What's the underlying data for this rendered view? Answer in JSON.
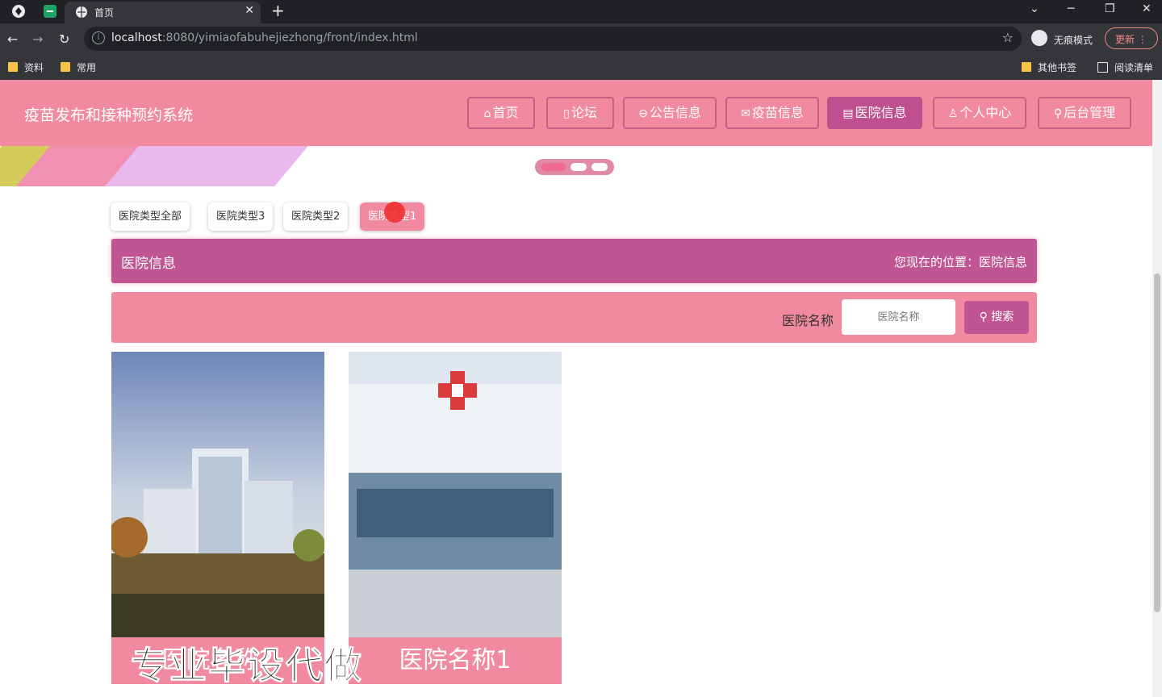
{
  "browser": {
    "tab_title": "首页",
    "new_tab": "+",
    "url_host": "localhost",
    "url_rest": ":8080/yimiaofabuhejiezhong/front/index.html",
    "incognito_label": "无痕模式",
    "update_label": "更新",
    "bookmarks": [
      "资料",
      "常用"
    ],
    "bookmarks_right": [
      "其他书签",
      "阅读清单"
    ]
  },
  "site": {
    "title": "疫苗发布和接种预约系统",
    "nav": [
      {
        "icon": "⌂",
        "label": "首页"
      },
      {
        "icon": "▯",
        "label": "论坛"
      },
      {
        "icon": "⊖",
        "label": "公告信息"
      },
      {
        "icon": "✉",
        "label": "疫苗信息"
      },
      {
        "icon": "▤",
        "label": "医院信息"
      },
      {
        "icon": "♙",
        "label": "个人中心"
      },
      {
        "icon": "⚲",
        "label": "后台管理"
      }
    ],
    "active_nav": "医院信息"
  },
  "filters": [
    "医院类型全部",
    "医院类型3",
    "医院类型2",
    "医院类型1"
  ],
  "section": {
    "title": "医院信息",
    "breadcrumb": "您现在的位置：医院信息"
  },
  "search": {
    "label": "医院名称",
    "placeholder": "医院名称",
    "button": "搜索"
  },
  "cards": [
    {
      "name": "医院名称2"
    },
    {
      "name": "医院名称1"
    }
  ],
  "watermark": "专业毕设代做",
  "colors": {
    "header": "#f28a9f",
    "accent": "#bf5593"
  }
}
